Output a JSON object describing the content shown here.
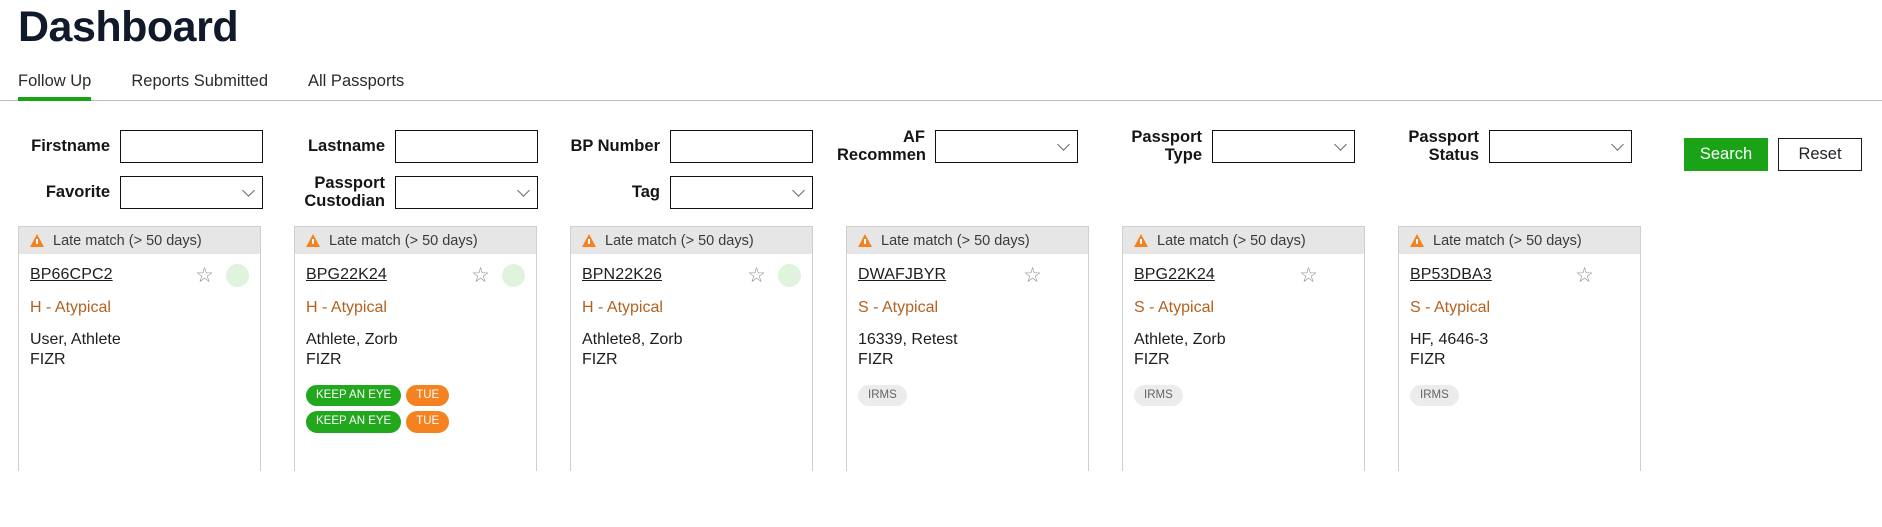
{
  "header": {
    "title": "Dashboard",
    "tabs": [
      {
        "label": "Follow Up",
        "active": true
      },
      {
        "label": "Reports Submitted",
        "active": false
      },
      {
        "label": "All Passports",
        "active": false
      }
    ]
  },
  "filters": {
    "row1": [
      {
        "label": "Firstname",
        "type": "text",
        "value": "",
        "placeholder": ""
      },
      {
        "label": "Lastname",
        "type": "text",
        "value": "",
        "placeholder": ""
      },
      {
        "label": "BP Number",
        "type": "text",
        "value": "",
        "placeholder": ""
      },
      {
        "label": "AF Recommendation",
        "type": "select",
        "value": ""
      },
      {
        "label": "Passport Type",
        "type": "select",
        "value": ""
      },
      {
        "label": "Passport Status",
        "type": "select",
        "value": ""
      }
    ],
    "row2": [
      {
        "label": "Favorite",
        "type": "select",
        "value": ""
      },
      {
        "label": "Passport Custodian",
        "type": "select",
        "value": ""
      },
      {
        "label": "Tag",
        "type": "select",
        "value": ""
      }
    ],
    "search_label": "Search",
    "reset_label": "Reset",
    "accent_green": "#1aa317"
  },
  "cards": [
    {
      "status": "Late match (> 50 days)",
      "bp_number": "BP66CPC2",
      "favorite": false,
      "has_dot": true,
      "recommendation": "H - Atypical",
      "subject": "User, Athlete",
      "lab": "FIZR",
      "tags": []
    },
    {
      "status": "Late match (> 50 days)",
      "bp_number": "BPG22K24",
      "favorite": false,
      "has_dot": true,
      "recommendation": "H - Atypical",
      "subject": "Athlete, Zorb",
      "lab": "FIZR",
      "tags": [
        {
          "label": "KEEP AN EYE",
          "color": "green"
        },
        {
          "label": "TUE",
          "color": "orange"
        },
        {
          "label": "KEEP AN EYE",
          "color": "green"
        },
        {
          "label": "TUE",
          "color": "orange"
        }
      ]
    },
    {
      "status": "Late match (> 50 days)",
      "bp_number": "BPN22K26",
      "favorite": false,
      "has_dot": true,
      "recommendation": "H - Atypical",
      "subject": "Athlete8, Zorb",
      "lab": "FIZR",
      "tags": []
    },
    {
      "status": "Late match (> 50 days)",
      "bp_number": "DWAFJBYR",
      "favorite": false,
      "has_dot": false,
      "recommendation": "S - Atypical",
      "subject": "16339, Retest",
      "lab": "FIZR",
      "tags": [
        {
          "label": "IRMS",
          "color": "gray"
        }
      ]
    },
    {
      "status": "Late match (> 50 days)",
      "bp_number": "BPG22K24",
      "favorite": false,
      "has_dot": false,
      "recommendation": "S - Atypical",
      "subject": "Athlete, Zorb",
      "lab": "FIZR",
      "tags": [
        {
          "label": "IRMS",
          "color": "gray"
        }
      ]
    },
    {
      "status": "Late match (> 50 days)",
      "bp_number": "BP53DBA3",
      "favorite": false,
      "has_dot": false,
      "recommendation": "S - Atypical",
      "subject": "HF, 4646-3",
      "lab": "FIZR",
      "tags": [
        {
          "label": "IRMS",
          "color": "gray"
        }
      ]
    }
  ],
  "icons": {
    "warning": "warning-triangle-icon",
    "star": "☆",
    "chevron": "chevron-down-icon"
  }
}
